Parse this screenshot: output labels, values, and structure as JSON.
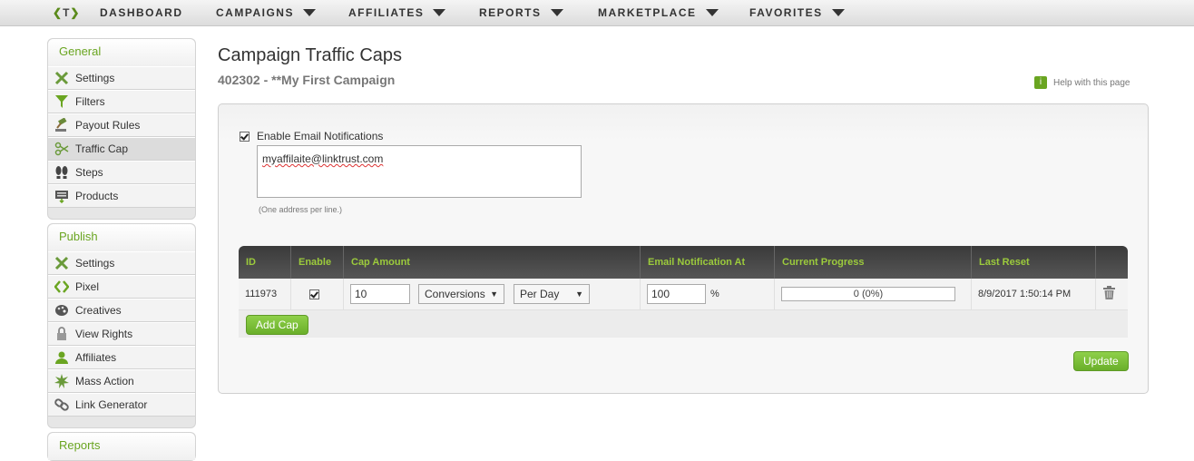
{
  "topnav": {
    "logo": "T",
    "items": [
      {
        "label": "DASHBOARD",
        "has_caret": false
      },
      {
        "label": "CAMPAIGNS",
        "has_caret": true
      },
      {
        "label": "AFFILIATES",
        "has_caret": true
      },
      {
        "label": "REPORTS",
        "has_caret": true
      },
      {
        "label": "MARKETPLACE",
        "has_caret": true
      },
      {
        "label": "FAVORITES",
        "has_caret": true
      }
    ]
  },
  "sidebar": {
    "general": {
      "title": "General",
      "items": [
        {
          "label": "Settings",
          "icon": "tools-icon"
        },
        {
          "label": "Filters",
          "icon": "funnel-icon"
        },
        {
          "label": "Payout Rules",
          "icon": "gavel-icon"
        },
        {
          "label": "Traffic Cap",
          "icon": "scissors-icon",
          "active": true
        },
        {
          "label": "Steps",
          "icon": "footprints-icon"
        },
        {
          "label": "Products",
          "icon": "product-icon"
        }
      ]
    },
    "publish": {
      "title": "Publish",
      "items": [
        {
          "label": "Settings",
          "icon": "tools-icon"
        },
        {
          "label": "Pixel",
          "icon": "code-icon"
        },
        {
          "label": "Creatives",
          "icon": "palette-icon"
        },
        {
          "label": "View Rights",
          "icon": "lock-icon"
        },
        {
          "label": "Affiliates",
          "icon": "user-icon"
        },
        {
          "label": "Mass Action",
          "icon": "burst-icon"
        },
        {
          "label": "Link Generator",
          "icon": "link-icon"
        }
      ]
    },
    "reports": {
      "title": "Reports"
    }
  },
  "main": {
    "title": "Campaign Traffic Caps",
    "subtitle": "402302 - **My First Campaign",
    "help_label": "Help with this page"
  },
  "email": {
    "enable_label": "Enable Email Notifications",
    "enabled": true,
    "value": "myaffilaite@linktrust.com",
    "hint": "(One address per line.)"
  },
  "caps_table": {
    "headers": [
      "ID",
      "Enable",
      "Cap Amount",
      "Email Notification At",
      "Current Progress",
      "Last Reset"
    ],
    "rows": [
      {
        "id": "111973",
        "enabled": true,
        "cap_amount": "10",
        "cap_type": "Conversions",
        "cap_period": "Per Day",
        "notify_at": "100",
        "notify_unit": "%",
        "progress_text": "0 (0%)",
        "progress_fraction": 0,
        "last_reset": "8/9/2017 1:50:14 PM"
      }
    ],
    "add_label": "Add Cap"
  },
  "update_label": "Update",
  "colors": {
    "accent": "#6aa521",
    "header_dark": "#454545",
    "header_text": "#9ccb3c"
  }
}
